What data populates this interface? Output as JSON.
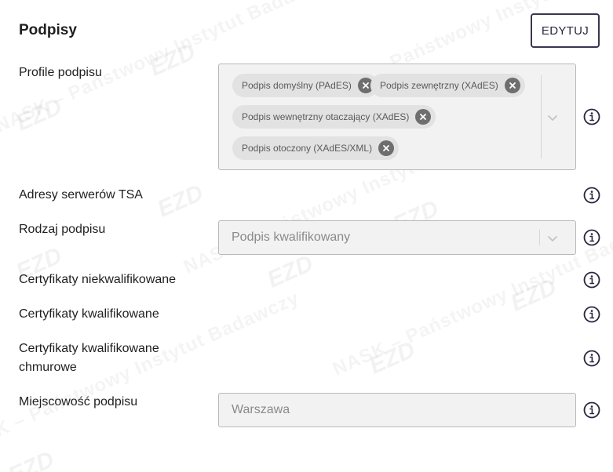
{
  "section": {
    "title": "Podpisy",
    "edit_label": "EDYTUJ"
  },
  "watermark": {
    "text": "NASK – Państwowy Instytut Badawczy",
    "logo": "EZD"
  },
  "fields": {
    "profiles": {
      "label": "Profile podpisu",
      "chips": [
        "Podpis domyślny (PAdES)",
        "Podpis zewnętrzny (XAdES)",
        "Podpis wewnętrzny otaczający (XAdES)",
        "Podpis otoczony (XAdES/XML)"
      ]
    },
    "tsa": {
      "label": "Adresy serwerów TSA"
    },
    "signature_type": {
      "label": "Rodzaj podpisu",
      "value": "Podpis kwalifikowany"
    },
    "unqualified_certs": {
      "label": "Certyfikaty niekwalifikowane"
    },
    "qualified_certs": {
      "label": "Certyfikaty kwalifikowane"
    },
    "cloud_certs": {
      "label": "Certyfikaty kwalifikowane chmurowe"
    },
    "signature_place": {
      "label": "Miejscowość podpisu",
      "value": "Warszawa"
    }
  },
  "icons": {
    "info": "info-circle-icon",
    "chip_remove": "close-circle-icon",
    "dropdown": "chevron-down-icon"
  },
  "colors": {
    "field_background": "#f2f2f2",
    "field_border": "#b8b8b8",
    "chip_background": "#e2e2e2",
    "button_border": "#3b3550"
  }
}
